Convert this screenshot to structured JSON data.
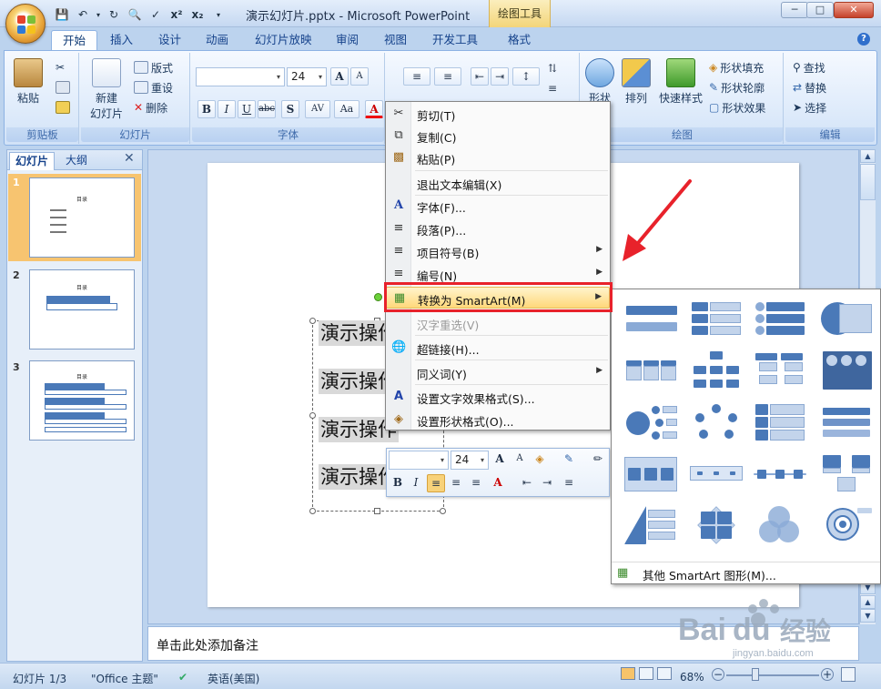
{
  "window": {
    "title": "演示幻灯片.pptx - Microsoft PowerPoint",
    "contextual_tab_group": "绘图工具",
    "minimize": "─",
    "maximize": "□",
    "close": "✕"
  },
  "ribbon_tabs": [
    "开始",
    "插入",
    "设计",
    "动画",
    "幻灯片放映",
    "审阅",
    "视图",
    "开发工具",
    "格式"
  ],
  "ribbon": {
    "clipboard": {
      "label": "剪贴板",
      "paste": "粘贴"
    },
    "slides": {
      "label": "幻灯片",
      "new_slide": "新建",
      "new_slide2": "幻灯片",
      "layout": "版式",
      "reset": "重设",
      "delete": "删除"
    },
    "font": {
      "label": "字体",
      "font_size": "24"
    },
    "drawing": {
      "label": "绘图",
      "shape": "形状",
      "arrange": "排列",
      "quick_styles": "快速样式",
      "fill": "形状填充",
      "outline": "形状轮廓",
      "effects": "形状效果"
    },
    "editing": {
      "label": "编辑",
      "find": "查找",
      "replace": "替换",
      "select": "选择"
    }
  },
  "left_pane": {
    "tabs": [
      "幻灯片",
      "大纲"
    ],
    "thumbnails": [
      {
        "num": "1",
        "title": "目录"
      },
      {
        "num": "2",
        "title": "目录"
      },
      {
        "num": "3",
        "title": "目录"
      }
    ]
  },
  "slide": {
    "lines": [
      "演示操作",
      "演示操作",
      "演示操作",
      "演示操作"
    ]
  },
  "notes_placeholder": "单击此处添加备注",
  "context_menu": {
    "items": [
      {
        "label": "剪切(T)",
        "icon": "scissors-icon"
      },
      {
        "label": "复制(C)",
        "icon": "copy-icon"
      },
      {
        "label": "粘贴(P)",
        "icon": "paste-icon"
      },
      {
        "label": "退出文本编辑(X)",
        "icon": ""
      },
      {
        "label": "字体(F)...",
        "icon": "font-icon"
      },
      {
        "label": "段落(P)...",
        "icon": "paragraph-icon"
      },
      {
        "label": "项目符号(B)",
        "icon": "bullets-icon"
      },
      {
        "label": "编号(N)",
        "icon": "numbering-icon"
      },
      {
        "label": "转换为 SmartArt(M)",
        "icon": "smartart-icon"
      },
      {
        "label": "汉字重选(V)",
        "icon": ""
      },
      {
        "label": "超链接(H)...",
        "icon": "hyperlink-icon"
      },
      {
        "label": "同义词(Y)",
        "icon": ""
      },
      {
        "label": "设置文字效果格式(S)...",
        "icon": "text-effects-icon"
      },
      {
        "label": "设置形状格式(O)...",
        "icon": "shape-format-icon"
      }
    ]
  },
  "smartart_gallery": {
    "more": "其他 SmartArt 图形(M)..."
  },
  "mini_toolbar": {
    "font_size": "24"
  },
  "status_bar": {
    "slide_info": "幻灯片 1/3",
    "theme": "\"Office 主题\"",
    "language": "英语(美国)",
    "zoom": "68%"
  },
  "watermark": {
    "brand": "Baidu经验",
    "url": "jingyan.baidu.com"
  },
  "colors": {
    "accent": "#4a79b8",
    "highlight": "#e8222b",
    "menu_hover": "#ffd87a"
  }
}
